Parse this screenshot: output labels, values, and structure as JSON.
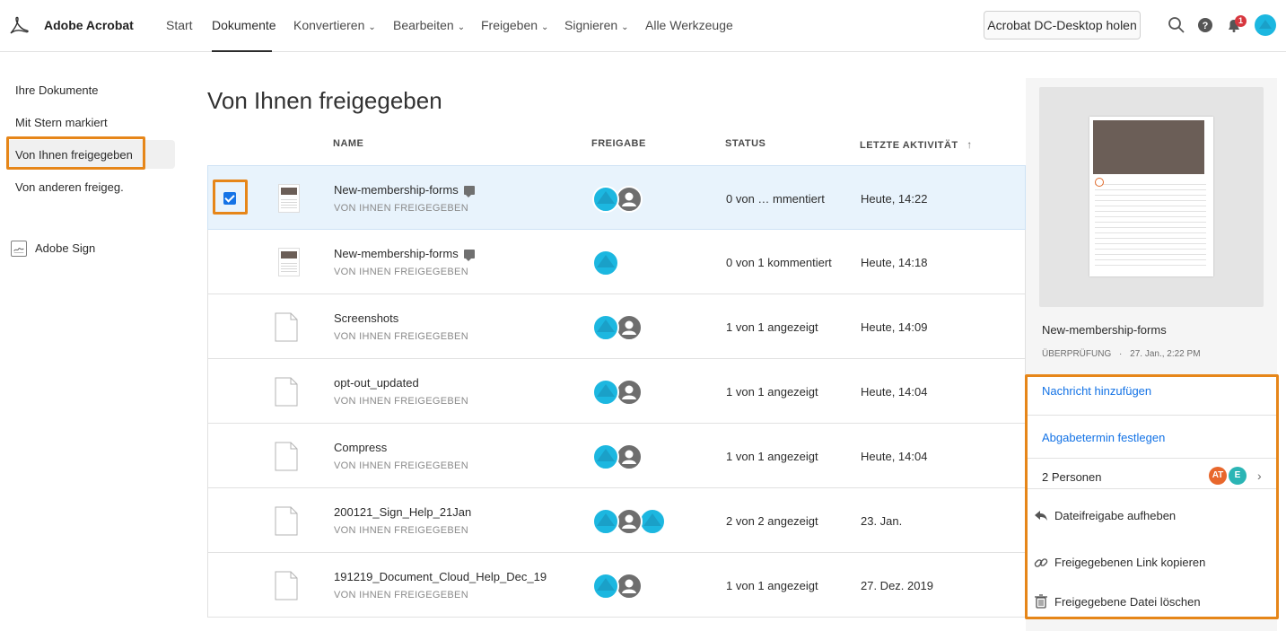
{
  "app": {
    "name": "Adobe Acrobat"
  },
  "nav": {
    "items": [
      {
        "label": "Start"
      },
      {
        "label": "Dokumente"
      },
      {
        "label": "Konvertieren"
      },
      {
        "label": "Bearbeiten"
      },
      {
        "label": "Freigeben"
      },
      {
        "label": "Signieren"
      },
      {
        "label": "Alle Werkzeuge"
      }
    ],
    "active": "Dokumente",
    "cta_label": "Acrobat DC-Desktop holen",
    "notification_count": "1"
  },
  "sidebar": {
    "items": [
      {
        "label": "Ihre Dokumente"
      },
      {
        "label": "Mit Stern markiert"
      },
      {
        "label": "Von Ihnen freigegeben"
      },
      {
        "label": "Von anderen freigeg."
      }
    ],
    "active": "Von Ihnen freigegeben",
    "sign_label": "Adobe Sign"
  },
  "main": {
    "title": "Von Ihnen freigegeben",
    "columns": {
      "name": "NAME",
      "sharing": "FREIGABE",
      "status": "STATUS",
      "activity": "LETZTE AKTIVITÄT",
      "activity_sort": "↑"
    },
    "rows": [
      {
        "name": "New-membership-forms",
        "sub": "VON IHNEN FREIGEGEBEN",
        "status": "0 von … mmentiert",
        "activity": "Heute, 14:22",
        "selected": true,
        "thumb": "form-thumbnail",
        "has_comment": true,
        "avatars": [
          "blue",
          "gray"
        ]
      },
      {
        "name": "New-membership-forms",
        "sub": "VON IHNEN FREIGEGEBEN",
        "status": "0 von 1 kommentiert",
        "activity": "Heute, 14:18",
        "selected": false,
        "thumb": "form-thumbnail",
        "has_comment": true,
        "avatars": [
          "blue"
        ]
      },
      {
        "name": "Screenshots",
        "sub": "VON IHNEN FREIGEGEBEN",
        "status": "1 von 1 angezeigt",
        "activity": "Heute, 14:09",
        "selected": false,
        "thumb": "file-icon",
        "has_comment": false,
        "avatars": [
          "blue",
          "gray"
        ]
      },
      {
        "name": "opt-out_updated",
        "sub": "VON IHNEN FREIGEGEBEN",
        "status": "1 von 1 angezeigt",
        "activity": "Heute, 14:04",
        "selected": false,
        "thumb": "file-icon",
        "has_comment": false,
        "avatars": [
          "blue",
          "gray"
        ]
      },
      {
        "name": "Compress",
        "sub": "VON IHNEN FREIGEGEBEN",
        "status": "1 von 1 angezeigt",
        "activity": "Heute, 14:04",
        "selected": false,
        "thumb": "file-icon",
        "has_comment": false,
        "avatars": [
          "blue",
          "gray"
        ]
      },
      {
        "name": "200121_Sign_Help_21Jan",
        "sub": "VON IHNEN FREIGEGEBEN",
        "status": "2 von 2 angezeigt",
        "activity": "23. Jan.",
        "selected": false,
        "thumb": "file-icon",
        "has_comment": false,
        "avatars": [
          "blue",
          "gray",
          "blue"
        ]
      },
      {
        "name": "191219_Document_Cloud_Help_Dec_19",
        "sub": "VON IHNEN FREIGEGEBEN",
        "status": "1 von 1 angezeigt",
        "activity": "27. Dez. 2019",
        "selected": false,
        "thumb": "file-icon",
        "has_comment": false,
        "avatars": [
          "blue",
          "gray"
        ]
      }
    ]
  },
  "details": {
    "file_name": "New-membership-forms",
    "meta_type": "ÜBERPRÜFUNG",
    "meta_sep": "·",
    "meta_date": "27. Jan., 2:22 PM",
    "add_message": "Nachricht hinzufügen",
    "set_deadline": "Abgabetermin festlegen",
    "people_label": "2 Personen",
    "people": [
      {
        "initials": "AT",
        "color": "#e8672c"
      },
      {
        "initials": "E",
        "color": "#2bb5b5"
      }
    ],
    "unshare": "Dateifreigabe aufheben",
    "copy_link": "Freigegebenen Link kopieren",
    "delete": "Freigegebene Datei löschen"
  },
  "colors": {
    "accent": "#1473e6",
    "highlight": "#e68619",
    "avatar_blue": "#1cb7e0",
    "avatar_gray": "#6e6e6e",
    "selected_row": "#e8f3fc"
  }
}
